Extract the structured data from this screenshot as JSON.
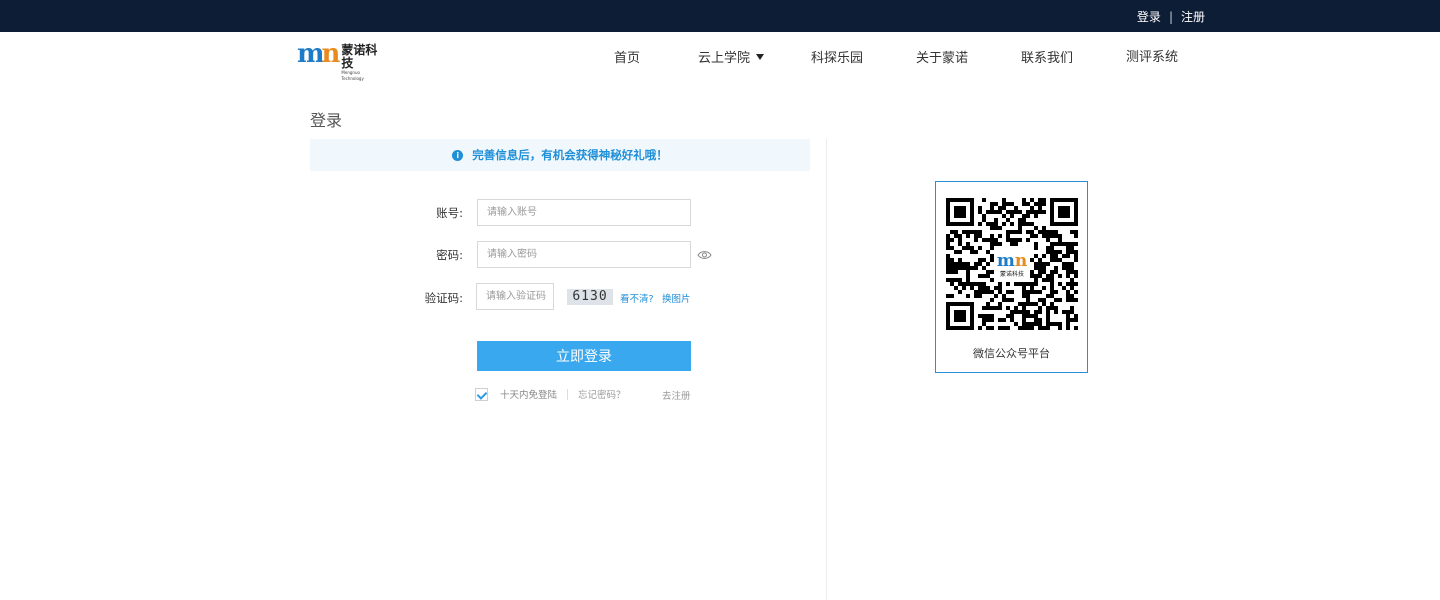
{
  "topbar": {
    "login": "登录",
    "separator": "|",
    "register": "注册"
  },
  "logo": {
    "mark_a": "m",
    "mark_b": "n",
    "name_cn": "蒙诺科技",
    "name_en": "Mengnuo Technology"
  },
  "nav": {
    "items": [
      {
        "label": "首页"
      },
      {
        "label": "云上学院",
        "has_dropdown": true
      },
      {
        "label": "科探乐园"
      },
      {
        "label": "关于蒙诺"
      },
      {
        "label": "联系我们"
      },
      {
        "label": "测评系统"
      }
    ]
  },
  "page": {
    "title": "登录"
  },
  "notice": {
    "text": "完善信息后，有机会获得神秘好礼哦！",
    "icon": "info-icon",
    "color": "#1f8fd8"
  },
  "form": {
    "account": {
      "label": "账号:",
      "placeholder": "请输入账号"
    },
    "password": {
      "label": "密码:",
      "placeholder": "请输入密码"
    },
    "captcha": {
      "label": "验证码:",
      "placeholder": "请输入验证码",
      "code": "6130",
      "unclear": "看不清?",
      "refresh": "换图片"
    },
    "submit": "立即登录",
    "remember_label": "十天内免登陆",
    "remember_checked": true,
    "forgot": "忘记密码？",
    "go_register": "去注册"
  },
  "qr": {
    "logo_text": "蒙诺科技",
    "caption": "微信公众号平台"
  },
  "colors": {
    "topbar": "#0e1d36",
    "accent": "#3aa8ee",
    "link": "#1f8fd8"
  }
}
